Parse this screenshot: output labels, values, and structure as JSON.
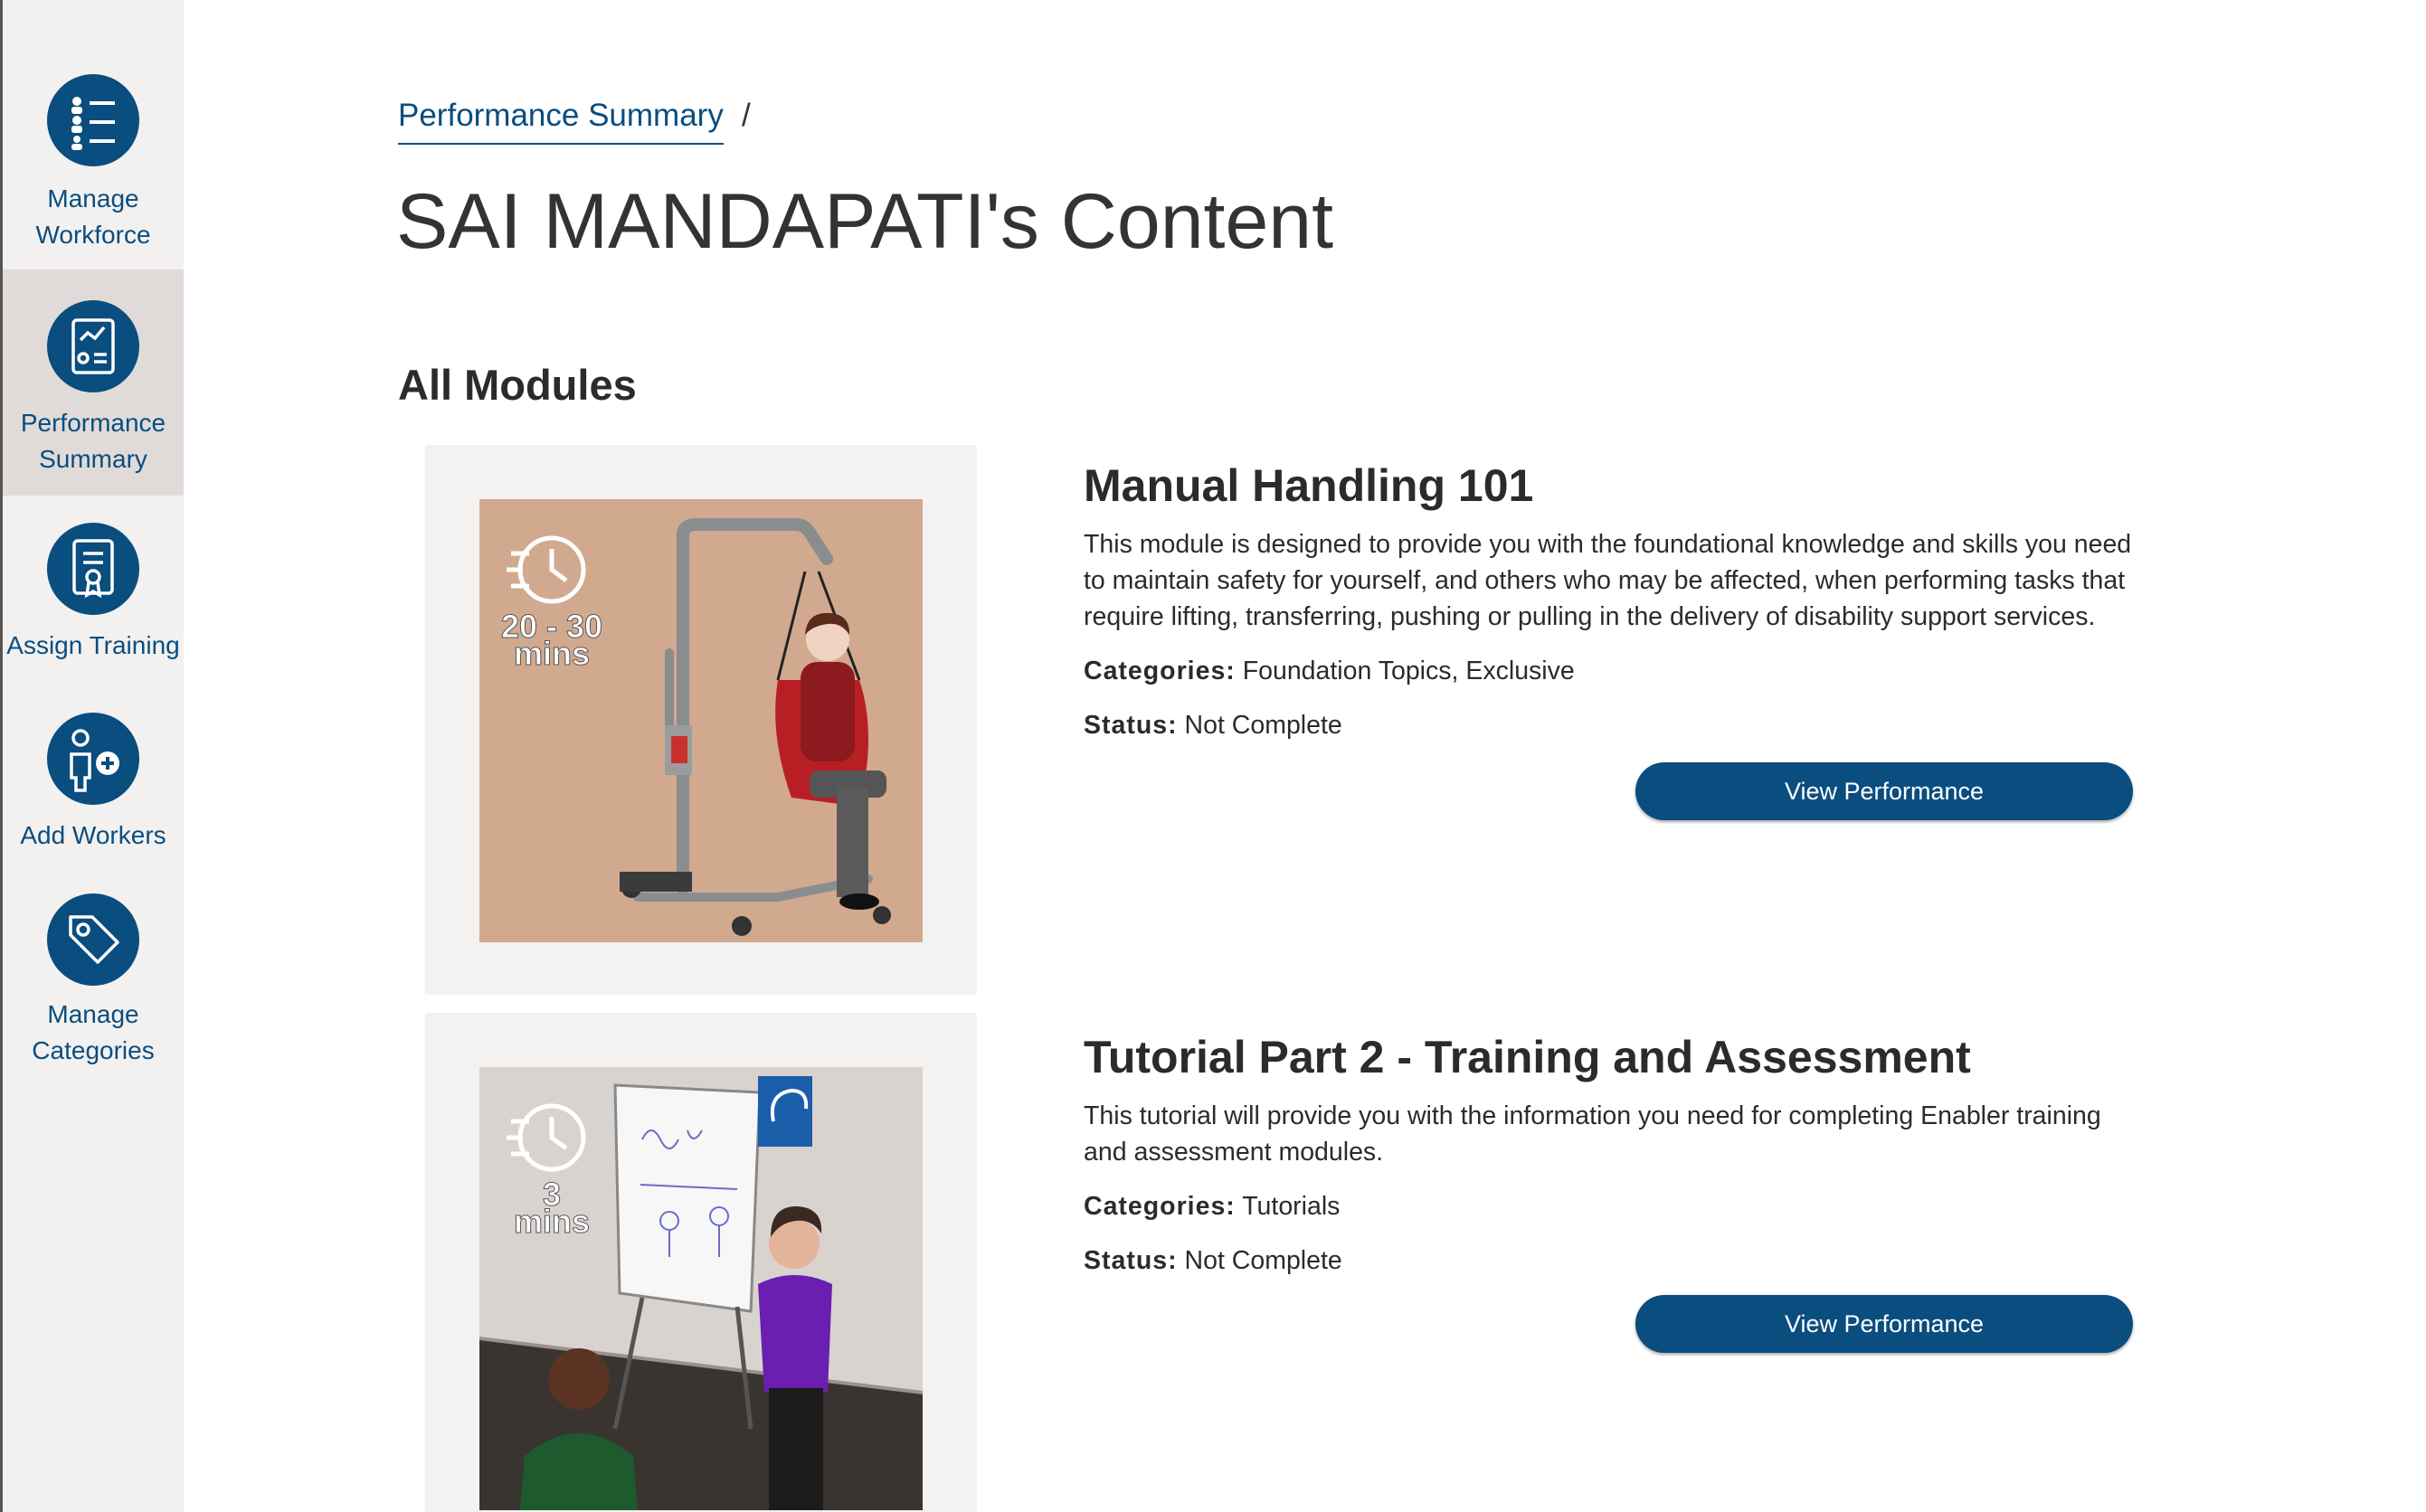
{
  "sidebar": {
    "items": [
      {
        "label": "Manage\nWorkforce",
        "icon": "people-list-icon",
        "active": false
      },
      {
        "label": "Performance\nSummary",
        "icon": "performance-chart-icon",
        "active": true
      },
      {
        "label": "Assign Training",
        "icon": "certificate-icon",
        "active": false
      },
      {
        "label": "Add Workers",
        "icon": "add-person-icon",
        "active": false
      },
      {
        "label": "Manage\nCategories",
        "icon": "tag-icon",
        "active": false
      }
    ]
  },
  "breadcrumb": {
    "link": "Performance Summary",
    "separator": "/"
  },
  "page": {
    "title": "SAI MANDAPATI's Content",
    "section": "All Modules"
  },
  "labels": {
    "categories": "Categories:",
    "status": "Status:"
  },
  "modules": [
    {
      "title": "Manual Handling 101",
      "description": "This module is designed to provide you with the foundational knowledge and skills you need to maintain safety for yourself, and others who may be affected, when performing tasks that require lifting, transferring, pushing or pulling in the delivery of disability support services.",
      "categories": "Foundation Topics, Exclusive",
      "status": "Not Complete",
      "duration_value": "20 - 30",
      "duration_unit": "mins",
      "button": "View Performance"
    },
    {
      "title": "Tutorial Part 2 - Training and Assessment",
      "description": "This tutorial will provide you with the information you need for completing Enabler training and assessment modules.",
      "categories": "Tutorials",
      "status": "Not Complete",
      "duration_value": "3",
      "duration_unit": "mins",
      "button": "View Performance"
    }
  ],
  "colors": {
    "primary": "#0a4d7f",
    "sidebar_bg": "#f2f1f0",
    "sidebar_active": "#e0dbd9",
    "card_bg": "#f3f2f1"
  }
}
